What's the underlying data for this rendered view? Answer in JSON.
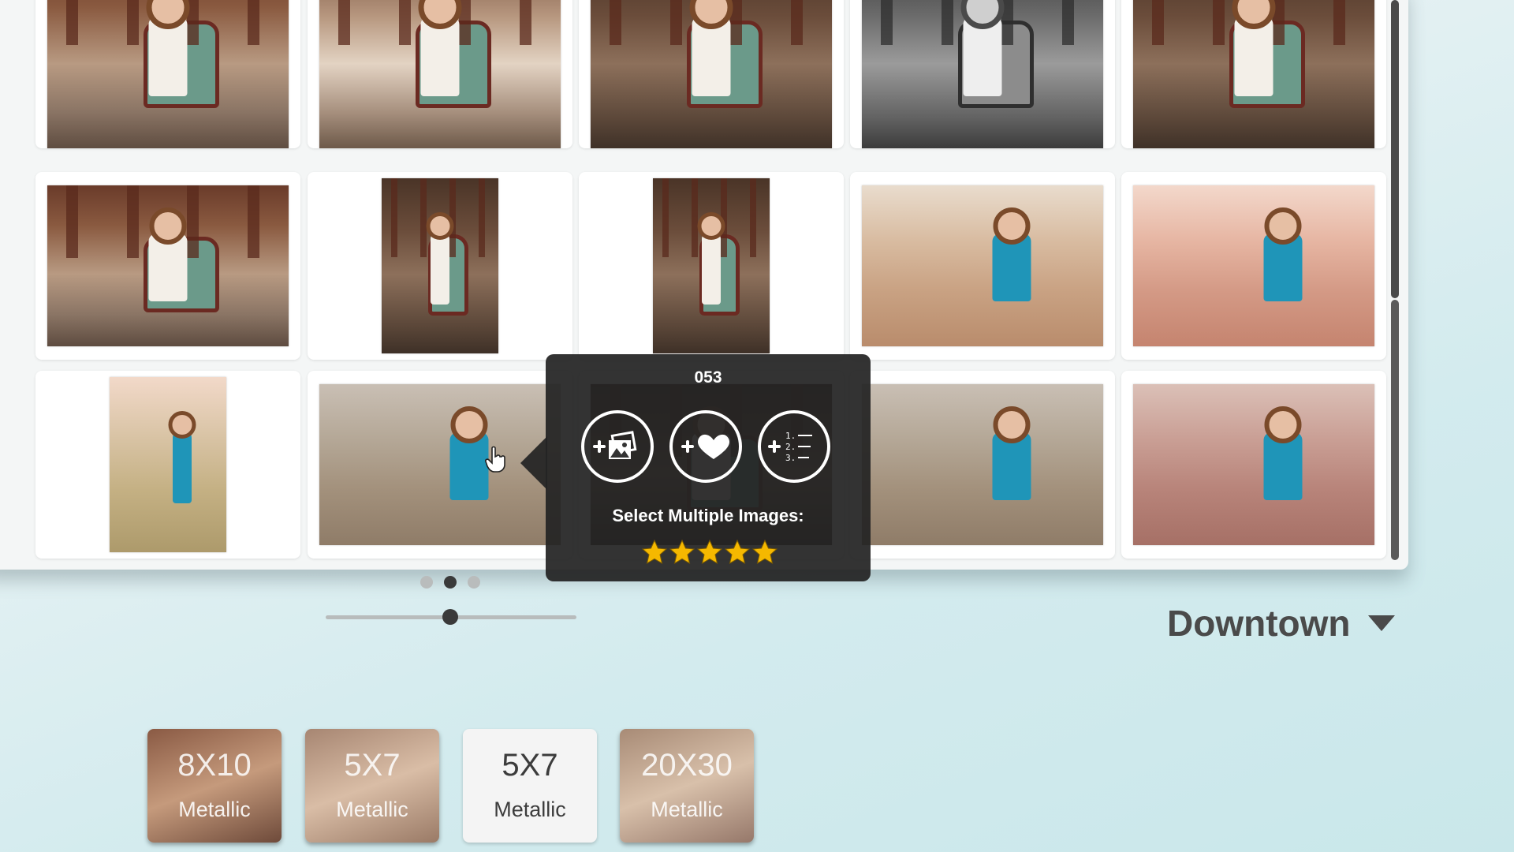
{
  "gallery": {
    "rows": [
      [
        {
          "theme": "arch-warm",
          "orientation": "landscape"
        },
        {
          "theme": "arch-lite",
          "orientation": "landscape"
        },
        {
          "theme": "arch-dark",
          "orientation": "landscape"
        },
        {
          "theme": "arch-bw",
          "orientation": "landscape"
        },
        {
          "theme": "arch-dark",
          "orientation": "landscape"
        }
      ],
      [
        {
          "theme": "arch-warm",
          "orientation": "landscape"
        },
        {
          "theme": "arch-dark",
          "orientation": "portrait"
        },
        {
          "theme": "arch-dark",
          "orientation": "portrait"
        },
        {
          "theme": "field-warm",
          "orientation": "landscape"
        },
        {
          "theme": "field-pink",
          "orientation": "landscape"
        }
      ],
      [
        {
          "theme": "field-vint",
          "orientation": "portrait"
        },
        {
          "theme": "field-dull",
          "orientation": "landscape"
        },
        {
          "theme": "arch-dark",
          "orientation": "landscape"
        },
        {
          "theme": "field-dull",
          "orientation": "landscape"
        },
        {
          "theme": "field-rose",
          "orientation": "landscape"
        }
      ]
    ]
  },
  "popup": {
    "image_number": "053",
    "actions": [
      {
        "name": "add-to-album",
        "icon": "add-photos-icon"
      },
      {
        "name": "add-to-favorites",
        "icon": "add-heart-icon"
      },
      {
        "name": "add-to-list",
        "icon": "add-numbered-list-icon"
      }
    ],
    "select_label": "Select Multiple Images:",
    "rating": 5,
    "star_color": "#f5b800"
  },
  "pagination": {
    "pages": 3,
    "current": 2
  },
  "zoom_slider": {
    "value": 0.5
  },
  "location": {
    "label": "Downtown"
  },
  "products": [
    {
      "size": "8X10",
      "finish": "Metallic",
      "style": "photo"
    },
    {
      "size": "5X7",
      "finish": "Metallic",
      "style": "photo"
    },
    {
      "size": "5X7",
      "finish": "Metallic",
      "style": "plain"
    },
    {
      "size": "20X30",
      "finish": "Metallic",
      "style": "photo"
    }
  ]
}
